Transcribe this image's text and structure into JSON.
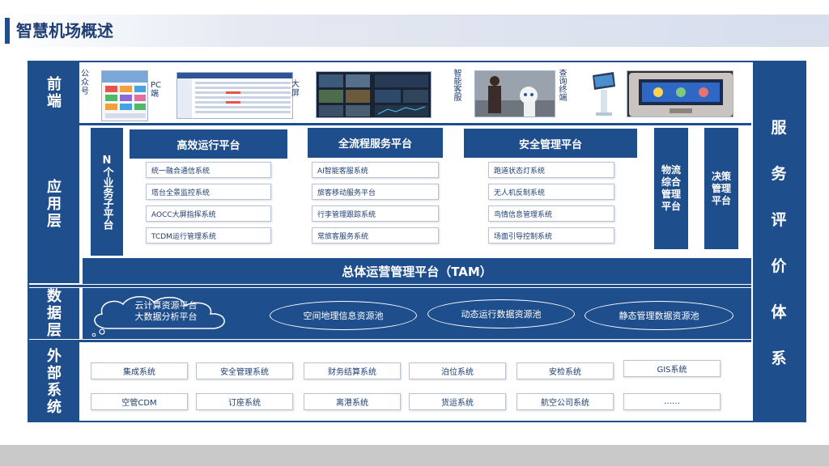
{
  "page": {
    "title": "智慧机场概述"
  },
  "layers": {
    "front": "前\n端",
    "app": "应\n用\n层",
    "data": "数\n据\n层",
    "external": "外\n部\n系\n统"
  },
  "front_end": {
    "public_account": "公众号",
    "pc": "PC端",
    "big_screen": "大屏",
    "smart_service": "智能客服",
    "query_terminal": "查询终端"
  },
  "app_layer": {
    "n_business": "N个业务子平台",
    "platforms": [
      {
        "title": "高效运行平台",
        "items": [
          "统一融合通信系统",
          "塔台全景监控系统",
          "AOCC大屏指挥系统",
          "TCDM运行管理系统"
        ]
      },
      {
        "title": "全流程服务平台",
        "items": [
          "AI智能客服系统",
          "旅客移动服务平台",
          "行李管理跟踪系统",
          "常旅客服务系统"
        ]
      },
      {
        "title": "安全管理平台",
        "items": [
          "跑道状态灯系统",
          "无人机反制系统",
          "鸟情信息管理系统",
          "场面引导控制系统"
        ]
      }
    ],
    "logistics": "物流综合管理平台",
    "decision": "决策管理平台",
    "tam": "总体运营管理平台（TAM）"
  },
  "data_layer": {
    "cloud": [
      "云计算资源平台",
      "大数据分析平台"
    ],
    "pools": [
      "空间地理信息资源池",
      "动态运行数据资源池",
      "静态管理数据资源池"
    ]
  },
  "external_systems": [
    [
      "集成系统",
      "安全管理系统",
      "财务结算系统",
      "泊位系统",
      "安检系统",
      "GIS系统"
    ],
    [
      "空管CDM",
      "订座系统",
      "离港系统",
      "货运系统",
      "航空公司系统",
      "……"
    ]
  ],
  "right_panel": {
    "chars": [
      "服",
      "务",
      "评",
      "价",
      "体",
      "系"
    ]
  },
  "colors": {
    "primary": "#1f4e8c",
    "title": "#1f3e73",
    "bottom": "#c9c9c9"
  }
}
